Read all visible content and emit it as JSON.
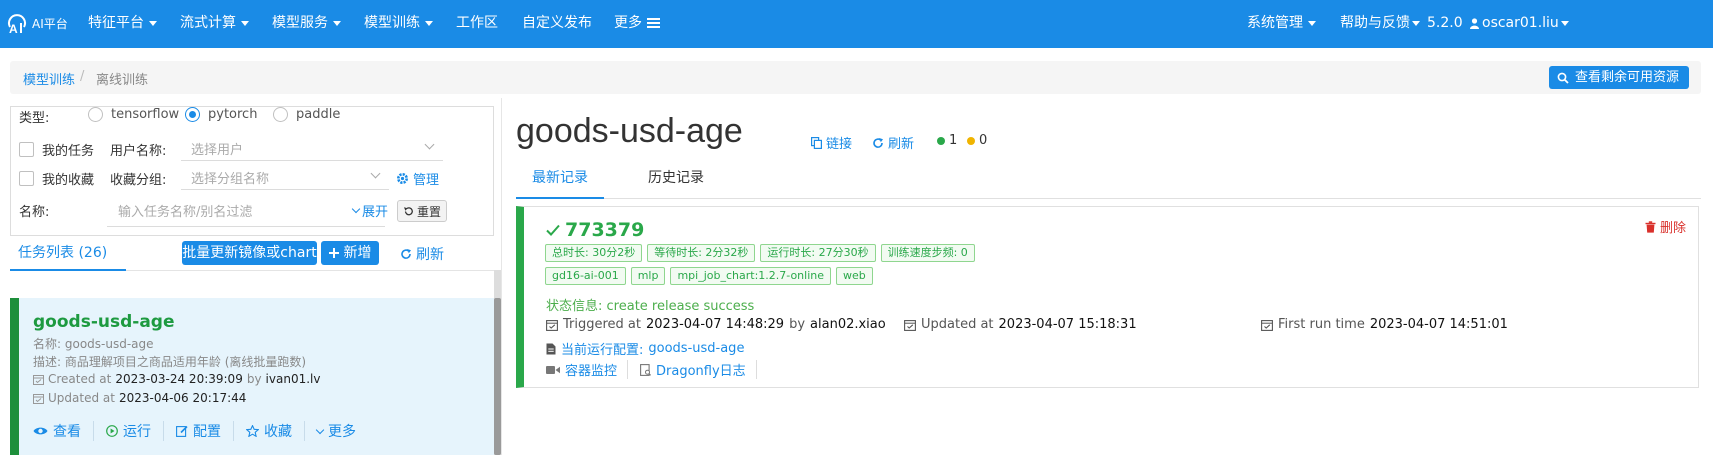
{
  "nav": {
    "logo_text": "AI平台",
    "items": [
      {
        "label": "特征平台",
        "dropdown": true
      },
      {
        "label": "流式计算",
        "dropdown": true
      },
      {
        "label": "模型服务",
        "dropdown": true
      },
      {
        "label": "模型训练",
        "dropdown": true
      },
      {
        "label": "工作区",
        "dropdown": false
      },
      {
        "label": "自定义发布",
        "dropdown": false
      },
      {
        "label": "更多",
        "dropdown": false,
        "icon": "menu-icon"
      }
    ],
    "right": {
      "system": "系统管理",
      "help": "帮助与反馈",
      "version": "5.2.0",
      "user": "oscar01.liu"
    },
    "color": "#1a8be6"
  },
  "breadcrumb": {
    "items": [
      "模型训练",
      "离线训练"
    ],
    "separator": "/",
    "resource_button": "查看剩余可用资源"
  },
  "filters": {
    "type_label": "类型:",
    "types": [
      {
        "label": "tensorflow",
        "selected": false
      },
      {
        "label": "pytorch",
        "selected": true
      },
      {
        "label": "paddle",
        "selected": false
      }
    ],
    "my_tasks": "我的任务",
    "user_name_label": "用户名称:",
    "user_select_placeholder": "选择用户",
    "my_favorites": "我的收藏",
    "fav_group_label": "收藏分组:",
    "fav_group_placeholder": "选择分组名称",
    "manage": "管理",
    "name_label": "名称:",
    "name_placeholder": "输入任务名称/别名过滤",
    "expand": "展开",
    "reset": "重置"
  },
  "task_list": {
    "tab_label": "任务列表 (26)",
    "batch_update": "批量更新镜像或chart",
    "add": "新增",
    "refresh": "刷新",
    "items": [
      {
        "title": "goods-usd-age",
        "alias_label": "名称:",
        "alias": "goods-usd-age",
        "desc_label": "描述:",
        "desc": "商品理解项目之商品适用年龄 (离线批量跑数)",
        "created_label": "Created at",
        "created_at": "2023-03-24 20:39:09",
        "by": "by",
        "created_by": "ivan01.lv",
        "updated_label": "Updated at",
        "updated_at": "2023-04-06 20:17:44",
        "actions": [
          "查看",
          "运行",
          "配置",
          "收藏",
          "更多"
        ]
      }
    ]
  },
  "job": {
    "title": "goods-usd-age",
    "link": "链接",
    "refresh": "刷新",
    "green_count": "1",
    "yellow_count": "0",
    "tabs": [
      "最新记录",
      "历史记录"
    ],
    "run": {
      "id": "773379",
      "tags_row1": [
        "总时长: 30分2秒",
        "等待时长: 2分32秒",
        "运行时长: 27分30秒",
        "训练速度步频: 0"
      ],
      "tags_row2": [
        "gd16-ai-001",
        "mlp",
        "mpi_job_chart:1.2.7-online",
        "web"
      ],
      "status_label": "状态信息:",
      "status": "create release success",
      "triggered_label": "Triggered at",
      "triggered_at": "2023-04-07 14:48:29",
      "by": "by",
      "triggered_by": "alan02.xiao",
      "updated_label": "Updated at",
      "updated_at": "2023-04-07 15:18:31",
      "first_run_label": "First run time",
      "first_run": "2023-04-07 14:51:01",
      "config_label": "当前运行配置:",
      "config": "goods-usd-age",
      "monitor": "容器监控",
      "dragonfly": "Dragonfly日志",
      "delete": "删除"
    }
  },
  "colors": {
    "primary": "#1a8be6",
    "success": "#2aa84a",
    "warning": "#f0b400",
    "danger": "#d9302b"
  }
}
